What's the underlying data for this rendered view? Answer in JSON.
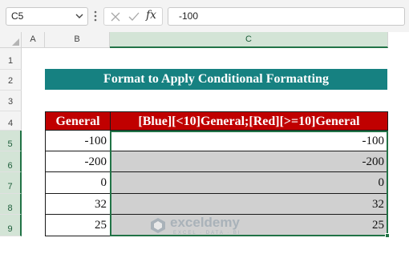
{
  "formula_bar": {
    "name_box": "C5",
    "cancel_icon": "cancel-icon",
    "enter_icon": "enter-icon",
    "fx_label": "fx",
    "formula": "-100"
  },
  "columns": [
    {
      "label": "A",
      "selected": false
    },
    {
      "label": "B",
      "selected": false
    },
    {
      "label": "C",
      "selected": true
    }
  ],
  "rows": [
    {
      "label": "1",
      "selected": false
    },
    {
      "label": "2",
      "selected": false
    },
    {
      "label": "3",
      "selected": false
    },
    {
      "label": "4",
      "selected": false
    },
    {
      "label": "5",
      "selected": true
    },
    {
      "label": "6",
      "selected": true
    },
    {
      "label": "7",
      "selected": true
    },
    {
      "label": "8",
      "selected": true
    },
    {
      "label": "9",
      "selected": true
    }
  ],
  "sheet": {
    "title": "Format to Apply Conditional Formatting",
    "table": {
      "headers": [
        "General",
        "[Blue][<10]General;[Red][>=10]General"
      ],
      "rows": [
        {
          "general": "-100",
          "formatted": "-100"
        },
        {
          "general": "-200",
          "formatted": "-200"
        },
        {
          "general": "0",
          "formatted": "0"
        },
        {
          "general": "32",
          "formatted": "32"
        },
        {
          "general": "25",
          "formatted": "25"
        }
      ]
    }
  },
  "watermark": {
    "name": "exceldemy",
    "tagline": "EXCEL · DATA · BI"
  },
  "colors": {
    "banner": "#168181",
    "header_fill": "#c00000",
    "selection": "#217346",
    "selected_fill": "#d0d0d0"
  }
}
